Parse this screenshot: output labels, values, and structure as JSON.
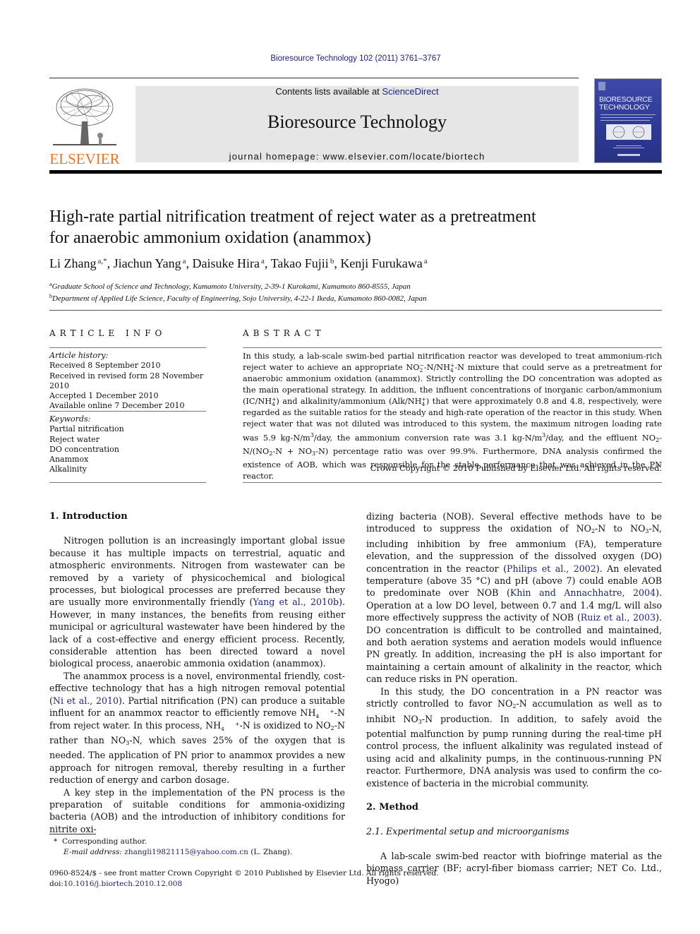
{
  "header": {
    "journal_reference": "Bioresource Technology 102 (2011) 3761–3767",
    "publisher_logo_text": "ELSEVIER",
    "contents_prefix": "Contents lists available at ",
    "contents_link": "ScienceDirect",
    "journal_title": "Bioresource Technology",
    "homepage": "journal homepage: www.elsevier.com/locate/biortech",
    "cover_title_line1": "BIORESOURCE",
    "cover_title_line2": "TECHNOLOGY"
  },
  "article": {
    "title_line1": "High-rate partial nitrification treatment of reject water as a pretreatment",
    "title_line2": "for anaerobic ammonium oxidation (anammox)",
    "authors": [
      {
        "name": "Li Zhang",
        "affil": "a,*"
      },
      {
        "name": "Jiachun Yang",
        "affil": "a"
      },
      {
        "name": "Daisuke Hira",
        "affil": "a"
      },
      {
        "name": "Takao Fujii",
        "affil": "b"
      },
      {
        "name": "Kenji Furukawa",
        "affil": "a"
      }
    ],
    "affiliations": [
      {
        "key": "a",
        "text": "Graduate School of Science and Technology, Kumamoto University, 2-39-1 Kurokami, Kumamoto 860-8555, Japan"
      },
      {
        "key": "b",
        "text": "Department of Applied Life Science, Faculty of Engineering, Sojo University, 4-22-1 Ikeda, Kumamoto 860-0082, Japan"
      }
    ]
  },
  "article_info": {
    "heading": "ARTICLE INFO",
    "history_label": "Article history:",
    "history": [
      "Received 8 September 2010",
      "Received in revised form 28 November 2010",
      "Accepted 1 December 2010",
      "Available online 7 December 2010"
    ],
    "keywords_label": "Keywords:",
    "keywords": [
      "Partial nitrification",
      "Reject water",
      "DO concentration",
      "Anammox",
      "Alkalinity"
    ]
  },
  "abstract": {
    "heading": "ABSTRACT",
    "s1": "In this study, a lab-scale swim-bed partial nitrification reactor was developed to treat ammonium-rich reject water to achieve an appropriate NO",
    "s2": "-N/NH",
    "s3": "-N mixture that could serve as a pretreatment for anaerobic ammonium oxidation (anammox). Strictly controlling the DO concentration was adopted as the main operational strategy. In addition, the influent concentrations of inorganic carbon/ammonium (IC/NH",
    "s4": ") and alkalinity/ammonium (Alk/NH",
    "s5": ") that were approximately 0.8 and 4.8, respectively, were regarded as the suitable ratios for the steady and high-rate operation of the reactor in this study. When reject water that was not diluted was introduced to this system, the maximum nitrogen loading rate was 5.9 kg-N/m",
    "s6": "/day, the ammonium conversion rate was 3.1 kg-N/m",
    "s7": "/day, and the effluent NO",
    "s8": "-N/(NO",
    "s9": "-N + NO",
    "s10": "-N) percentage ratio was over 99.9%. Furthermore, DNA analysis confirmed the existence of AOB, which was responsible for the stable performance that was achieved in the PN reactor.",
    "copyright": "Crown Copyright © 2010 Published by Elsevier Ltd. All rights reserved."
  },
  "body": {
    "intro_heading": "1. Introduction",
    "intro_p1a": "Nitrogen pollution is an increasingly important global issue because it has multiple impacts on terrestrial, aquatic and atmospheric environments. Nitrogen from wastewater can be removed by a variety of physicochemical and biological processes, but biological processes are preferred because they are usually more environmentally friendly (",
    "ref_yang": "Yang et al., 2010b",
    "intro_p1b": "). However, in many instances, the benefits from reusing either municipal or agricultural wastewater have been hindered by the lack of a cost-effective and energy efficient process. Recently, considerable attention has been directed toward a novel biological process, anaerobic ammonia oxidation (anammox).",
    "intro_p2a": "The anammox process is a novel, environmental friendly, cost-effective technology that has a high nitrogen removal potential (",
    "ref_ni": "Ni et al., 2010",
    "intro_p2b": "). Partial nitrification (PN) can produce a suitable influent for an anammox reactor to efficiently remove NH",
    "intro_p2c": "-N from reject water. In this process, NH",
    "intro_p2d": "-N is oxidized to NO",
    "intro_p2e": "-N rather than NO",
    "intro_p2f": "-N, which saves 25% of the oxygen that is needed. The application of PN prior to anammox provides a new approach for nitrogen removal, thereby resulting in a further reduction of energy and carbon dosage.",
    "intro_p3": "A key step in the implementation of the PN process is the preparation of suitable conditions for ammonia-oxidizing bacteria (AOB) and the introduction of inhibitory conditions for nitrite oxi-",
    "right_p1a": "dizing bacteria (NOB). Several effective methods have to be introduced to suppress the oxidation of NO",
    "right_p1b": "-N to NO",
    "right_p1c": "-N, including inhibition by free ammonium (FA), temperature elevation, and the suppression of the dissolved oxygen (DO) concentration in the reactor (",
    "ref_philips": "Philips et al., 2002",
    "right_p1d": "). An elevated temperature (above 35 °C) and pH (above 7) could enable AOB to predominate over NOB (",
    "ref_khin": "Khin and Annachhatre, 2004",
    "right_p1e": "). Operation at a low DO level, between 0.7 and 1.4 mg/L will also more effectively suppress the activity of NOB (",
    "ref_ruiz": "Ruiz et al., 2003",
    "right_p1f": "). DO concentration is difficult to be controlled and maintained, and both aeration systems and aeration models would influence PN greatly. In addition, increasing the pH is also important for maintaining a certain amount of alkalinity in the reactor, which can reduce risks in PN operation.",
    "right_p2a": "In this study, the DO concentration in a PN reactor was strictly controlled to favor NO",
    "right_p2b": "-N accumulation as well as to inhibit NO",
    "right_p2c": "-N production. In addition, to safely avoid the potential malfunction by pump running during the real-time pH control process, the influent alkalinity was regulated instead of using acid and alkalinity pumps, in the continuous-running PN reactor. Furthermore, DNA analysis was used to confirm the co-existence of bacteria in the microbial community.",
    "method_heading": "2. Method",
    "subsection_heading": "2.1. Experimental setup and microorganisms",
    "method_p1": "A lab-scale swim-bed reactor with biofringe material as the biomass carrier (BF; acryl-fiber biomass carrier; NET Co. Ltd., Hyogo)"
  },
  "footnotes": {
    "star": "*",
    "corresponding": "Corresponding author.",
    "email_label": "E-mail address:",
    "email": "zhangli19821115@yahoo.com.cn",
    "email_suffix": "(L. Zhang).",
    "front_matter": "0960-8524/$ - see front matter Crown Copyright © 2010 Published by Elsevier Ltd. All rights reserved.",
    "doi_label": "doi:",
    "doi": "10.1016/j.biortech.2010.12.008"
  }
}
